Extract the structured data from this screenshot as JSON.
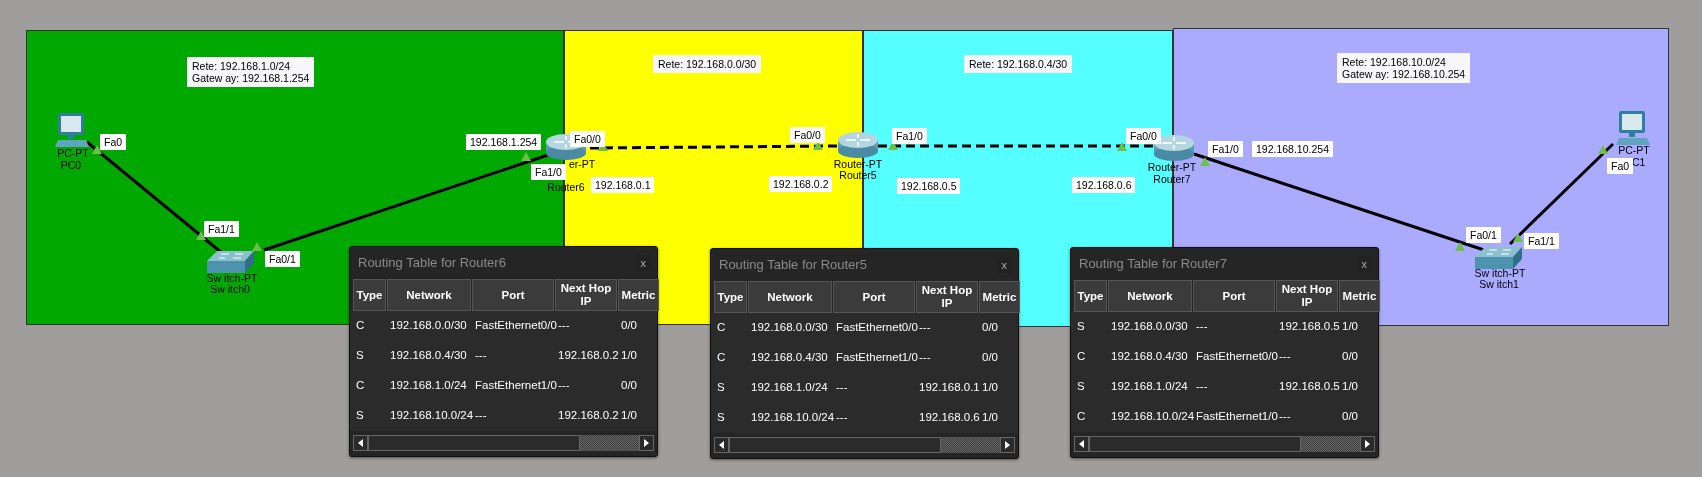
{
  "canvas": {
    "zones": [
      {
        "color": "#00a800"
      },
      {
        "color": "#ffff00"
      },
      {
        "color": "#55ffff"
      },
      {
        "color": "#aaaaff"
      }
    ],
    "notes": [
      {
        "lines": [
          "Rete: 192.168.1.0/24",
          "Gatew ay: 192.168.1.254"
        ]
      },
      {
        "lines": [
          "Rete: 192.168.0.0/30"
        ]
      },
      {
        "lines": [
          "Rete: 192.168.0.4/30"
        ]
      },
      {
        "lines": [
          "Rete: 192.168.10.0/24",
          "Gatew ay: 192.168.10.254"
        ]
      }
    ],
    "links": [
      {
        "kind": "straight"
      },
      {
        "kind": "straight"
      },
      {
        "kind": "dashed"
      },
      {
        "kind": "dashed"
      },
      {
        "kind": "straight"
      },
      {
        "kind": "straight"
      }
    ],
    "devices": [
      {
        "kind": "pc",
        "model": "PC-PT",
        "name": "PC0"
      },
      {
        "kind": "switch",
        "model": "Sw itch-PT",
        "name": "Sw itch0"
      },
      {
        "kind": "router",
        "model": "er-PT",
        "name": "Router6"
      },
      {
        "kind": "router",
        "model": "Router-PT",
        "name": "Router5"
      },
      {
        "kind": "router",
        "model": "Router-PT",
        "name": "Router7"
      },
      {
        "kind": "switch",
        "model": "Sw itch-PT",
        "name": "Sw itch1"
      },
      {
        "kind": "pc",
        "model": "PC-PT",
        "name": "C1"
      }
    ],
    "labels": [
      "Fa0",
      "Fa1/1",
      "Fa0/1",
      "192.168.1.254",
      "Fa1/0",
      "Fa0/0",
      "192.168.0.1",
      "Fa0/0",
      "192.168.0.2",
      "Fa1/0",
      "192.168.0.5",
      "Fa0/0",
      "192.168.0.6",
      "Fa1/0",
      "192.168.10.254",
      "Fa0/1",
      "Fa1/1",
      "Fa0"
    ]
  },
  "windows": [
    {
      "title": "Routing Table for Router6",
      "close": "x",
      "columns": [
        "Type",
        "Network",
        "Port",
        "Next Hop IP",
        "Metric"
      ],
      "rows": [
        [
          "C",
          "192.168.0.0/30",
          "FastEthernet0/0",
          "---",
          "0/0"
        ],
        [
          "S",
          "192.168.0.4/30",
          "---",
          "192.168.0.2",
          "1/0"
        ],
        [
          "C",
          "192.168.1.0/24",
          "FastEthernet1/0",
          "---",
          "0/0"
        ],
        [
          "S",
          "192.168.10.0/24",
          "---",
          "192.168.0.2",
          "1/0"
        ]
      ]
    },
    {
      "title": "Routing Table for Router5",
      "close": "x",
      "columns": [
        "Type",
        "Network",
        "Port",
        "Next Hop IP",
        "Metric"
      ],
      "rows": [
        [
          "C",
          "192.168.0.0/30",
          "FastEthernet0/0",
          "---",
          "0/0"
        ],
        [
          "C",
          "192.168.0.4/30",
          "FastEthernet1/0",
          "---",
          "0/0"
        ],
        [
          "S",
          "192.168.1.0/24",
          "---",
          "192.168.0.1",
          "1/0"
        ],
        [
          "S",
          "192.168.10.0/24",
          "---",
          "192.168.0.6",
          "1/0"
        ]
      ]
    },
    {
      "title": "Routing Table for Router7",
      "close": "x",
      "columns": [
        "Type",
        "Network",
        "Port",
        "Next Hop IP",
        "Metric"
      ],
      "rows": [
        [
          "S",
          "192.168.0.0/30",
          "---",
          "192.168.0.5",
          "1/0"
        ],
        [
          "C",
          "192.168.0.4/30",
          "FastEthernet0/0",
          "---",
          "0/0"
        ],
        [
          "S",
          "192.168.1.0/24",
          "---",
          "192.168.0.5",
          "1/0"
        ],
        [
          "C",
          "192.168.10.0/24",
          "FastEthernet1/0",
          "---",
          "0/0"
        ]
      ]
    }
  ]
}
